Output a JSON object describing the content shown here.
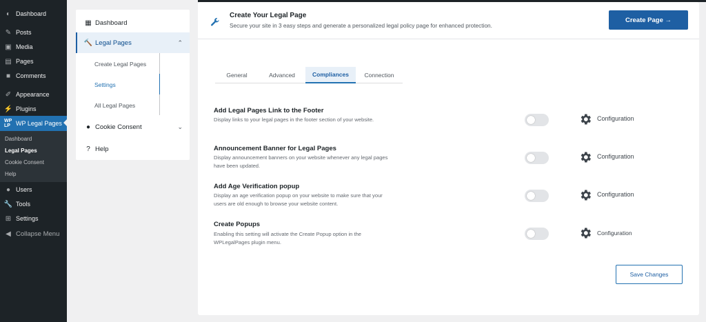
{
  "wp_menu": {
    "items": [
      {
        "label": "Dashboard",
        "icon": "dashboard-icon"
      },
      {
        "label": "Posts",
        "icon": "pin-icon"
      },
      {
        "label": "Media",
        "icon": "media-icon"
      },
      {
        "label": "Pages",
        "icon": "pages-icon"
      },
      {
        "label": "Comments",
        "icon": "comments-icon"
      },
      {
        "label": "Appearance",
        "icon": "appearance-icon"
      },
      {
        "label": "Plugins",
        "icon": "plugins-icon"
      },
      {
        "label": "WP Legal Pages",
        "icon": "wplp-icon",
        "icon_text": "WP LP"
      },
      {
        "label": "Users",
        "icon": "users-icon"
      },
      {
        "label": "Tools",
        "icon": "tools-icon"
      },
      {
        "label": "Settings",
        "icon": "settings-icon"
      },
      {
        "label": "Collapse Menu",
        "icon": "collapse-icon"
      }
    ],
    "submenu": [
      "Dashboard",
      "Legal Pages",
      "Cookie Consent",
      "Help"
    ]
  },
  "plugin_nav": {
    "dashboard": "Dashboard",
    "legal_pages": "Legal Pages",
    "sub": [
      "Create Legal Pages",
      "Settings",
      "All Legal Pages"
    ],
    "cookie_consent": "Cookie Consent",
    "help": "Help"
  },
  "header": {
    "title": "Create Your Legal Page",
    "subtitle": "Secure your site in 3 easy steps and generate a personalized legal policy page for enhanced protection.",
    "create_button": "Create Page →"
  },
  "tabs": [
    "General",
    "Advanced",
    "Compliances",
    "Connection"
  ],
  "active_tab": "Compliances",
  "settings": [
    {
      "title": "Add Legal Pages Link to the Footer",
      "desc": [
        "Display links to your legal pages in the footer section of your website."
      ],
      "enabled": false,
      "config": "Configuration"
    },
    {
      "title": "Announcement Banner for Legal Pages",
      "desc": [
        "Display announcement banners on your website whenever any legal pages",
        "have been updated."
      ],
      "enabled": false,
      "config": "Configuration"
    },
    {
      "title": "Add Age Verification popup",
      "desc": [
        "Display an age verification popup on your website to make sure that your",
        "users are old enough to browse your website content."
      ],
      "enabled": false,
      "config": "Configuration"
    },
    {
      "title": "Create Popups",
      "desc": [
        "Enabling this setting will activate the Create Popup option in the",
        "WPLegalPages plugin menu."
      ],
      "enabled": false,
      "config": "Configuration"
    }
  ],
  "save_button": "Save Changes",
  "colors": {
    "accent": "#1e5fa3",
    "wp_sidebar": "#1d2327",
    "wp_active": "#2271b1"
  }
}
